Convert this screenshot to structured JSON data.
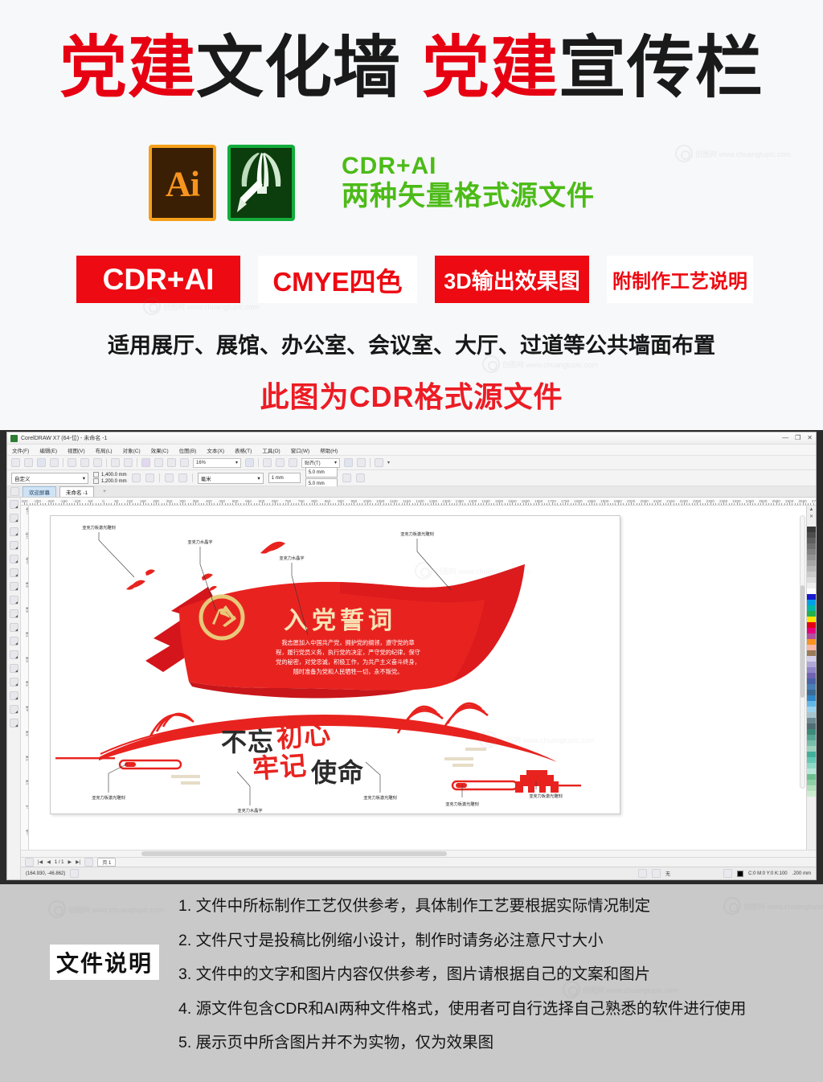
{
  "promo": {
    "title_parts": [
      {
        "text": "党建",
        "color": "red"
      },
      {
        "text": "文化墙",
        "color": "black"
      },
      {
        "text": "党建",
        "color": "red"
      },
      {
        "text": "宣传栏",
        "color": "black"
      }
    ],
    "title_full": "党建文化墙 党建宣传栏",
    "ai_icon_label": "Ai",
    "cdr_icon_label": "CorelDRAW",
    "green_line1": "CDR+AI",
    "green_line2": "两种矢量格式源文件",
    "badges": [
      {
        "label": "CDR+AI",
        "style": "filled"
      },
      {
        "label": "CMYE四色",
        "style": "outline"
      },
      {
        "label": "3D输出效果图",
        "style": "filled"
      },
      {
        "label": "附制作工艺说明",
        "style": "outline"
      }
    ],
    "applies_text": "适用展厅、展馆、办公室、会议室、大厅、过道等公共墙面布置",
    "cdr_note": "此图为CDR格式源文件",
    "colors": {
      "red": "#e60012",
      "badge_red": "#ed0a12",
      "green": "#4cbb17",
      "black": "#1a1a1a"
    },
    "watermark_text": "创图网  www.chuangtupic.com"
  },
  "coreldraw": {
    "titlebar": {
      "title": "CorelDRAW X7 (64-位) - 未命名 -1",
      "minimize": "—",
      "restore": "❐",
      "close": "✕"
    },
    "menus": [
      "文件(F)",
      "编辑(E)",
      "视图(V)",
      "布局(L)",
      "对象(C)",
      "效果(C)",
      "位图(B)",
      "文本(X)",
      "表格(T)",
      "工具(O)",
      "窗口(W)",
      "帮助(H)"
    ],
    "toolbar": {
      "zoom_value": "16%",
      "zoom_caret": "▾",
      "snap_label": "贴齐(T)",
      "snap_caret": "▾",
      "options_caret": "▾"
    },
    "propbar": {
      "preset": "自定义",
      "caret": "▾",
      "width": "1,400.0 mm",
      "height": "1,200.0 mm",
      "units": "毫米",
      "nudge": "1 mm",
      "bleed_x": "5.0 mm",
      "bleed_y": "5.0 mm"
    },
    "tabs": [
      {
        "label": "欢迎屏幕",
        "active": false
      },
      {
        "label": "未命名 -1",
        "active": true
      },
      {
        "label": "+",
        "active": false
      }
    ],
    "ruler": {
      "h_labels": [
        "-300",
        "-250",
        "-200",
        "-150",
        "-100",
        "-50",
        "0",
        "50",
        "100",
        "150",
        "200",
        "250",
        "300",
        "350",
        "400",
        "450",
        "500",
        "550",
        "600",
        "650",
        "700",
        "750",
        "800",
        "850",
        "900",
        "950",
        "1000",
        "1050",
        "1100",
        "1150",
        "1200",
        "1250",
        "1300",
        "1350",
        "1400",
        "1450",
        "1500",
        "1550",
        "1600",
        "1650",
        "1700",
        "1750",
        "1800",
        "1850",
        "1900",
        "1950",
        "2000",
        "2050",
        "2100",
        "2150",
        "2200",
        "2250",
        "2300",
        "2350",
        "2400",
        "2450",
        "2500",
        "2550",
        "2600",
        "2650",
        "2700"
      ],
      "v_labels": [
        "1200",
        "1100",
        "1000",
        "900",
        "800",
        "700",
        "600",
        "500",
        "400",
        "300",
        "200",
        "100",
        "0",
        "-100"
      ]
    },
    "pagenav": {
      "first": "|◀",
      "prev": "◀",
      "counter": "1 / 1",
      "next": "▶",
      "last": "▶|",
      "add": "▤",
      "page_tab": "页 1"
    },
    "statusbar": {
      "coords": "(164.930, -46.862)",
      "outline_label": "无",
      "fill_info": "C:0 M:0 Y:0 K:100",
      "outline_width": ".200 mm"
    },
    "artwork": {
      "title": "入党誓词",
      "oath_text": "我志愿加入中国共产党，拥护党的纲领，遵守党的章程，履行党员义务，执行党的决定，严守党的纪律，保守党的秘密，对党忠诚，积极工作，为共产主义奋斗终身，随时准备为党和人民牺牲一切，永不叛党。",
      "slogan_line1": "不忘初心",
      "slogan_line2": "牢记使命",
      "emblem": "党徽",
      "building_label": "天安门",
      "annotations": [
        {
          "label": "亚克力板激光雕刻",
          "pos": "top-left"
        },
        {
          "label": "亚克力水晶字",
          "pos": "top-mid-left"
        },
        {
          "label": "亚克力水晶字",
          "pos": "top-mid"
        },
        {
          "label": "亚克力板激光雕刻",
          "pos": "top-right"
        },
        {
          "label": "亚克力板激光雕刻",
          "pos": "bottom-left"
        },
        {
          "label": "亚克力水晶字",
          "pos": "bottom-mid-left"
        },
        {
          "label": "亚克力板激光雕刻",
          "pos": "bottom-mid"
        },
        {
          "label": "亚克力板激光雕刻",
          "pos": "bottom-mid-right"
        },
        {
          "label": "亚克力板激光雕刻",
          "pos": "bottom-right"
        }
      ],
      "colors": {
        "flag_red": "#e8231f",
        "flag_dark": "#c8161a",
        "title_gold": "#f7e3b6",
        "emblem_gold": "#e8c87a"
      }
    },
    "palette_colors": [
      "#3a3a3a",
      "#4d4d4d",
      "#5f5f5f",
      "#707070",
      "#828282",
      "#949494",
      "#a6a6a6",
      "#b8b8b8",
      "#cacaca",
      "#dcdcdc",
      "#eeeeee",
      "#ffffff",
      "#1a1acd",
      "#00a0e9",
      "#00b7a8",
      "#22b14c",
      "#ffe400",
      "#e60012",
      "#e6007e",
      "#b14fa0",
      "#f7931e",
      "#f7b8a8",
      "#9a7b5a",
      "#d5d0ea",
      "#b0a7d8",
      "#8f86c8",
      "#6f64b4",
      "#4a62a8",
      "#4a7fb5",
      "#3b6a94",
      "#2f88c8",
      "#63b8e8",
      "#9cd2ee",
      "#a8c4cc",
      "#6d8a92",
      "#4f6f74",
      "#3e8a7a",
      "#56a593",
      "#78bda9",
      "#9ed2bf",
      "#40b09a",
      "#62c8b4",
      "#8fd9c8",
      "#b6e6d8",
      "#6dbf8f",
      "#8fd1a6",
      "#b2e0be",
      "#cdeccf"
    ]
  },
  "notes": {
    "label": "文件说明",
    "items": [
      "1. 文件中所标制作工艺仅供参考，具体制作工艺要根据实际情况制定",
      "2. 文件尺寸是投稿比例缩小设计，制作时请务必注意尺寸大小",
      "3. 文件中的文字和图片内容仅供参考，图片请根据自己的文案和图片",
      "4. 源文件包含CDR和AI两种文件格式，使用者可自行选择自己熟悉的软件进行使用",
      "5. 展示页中所含图片并不为实物，仅为效果图"
    ]
  }
}
